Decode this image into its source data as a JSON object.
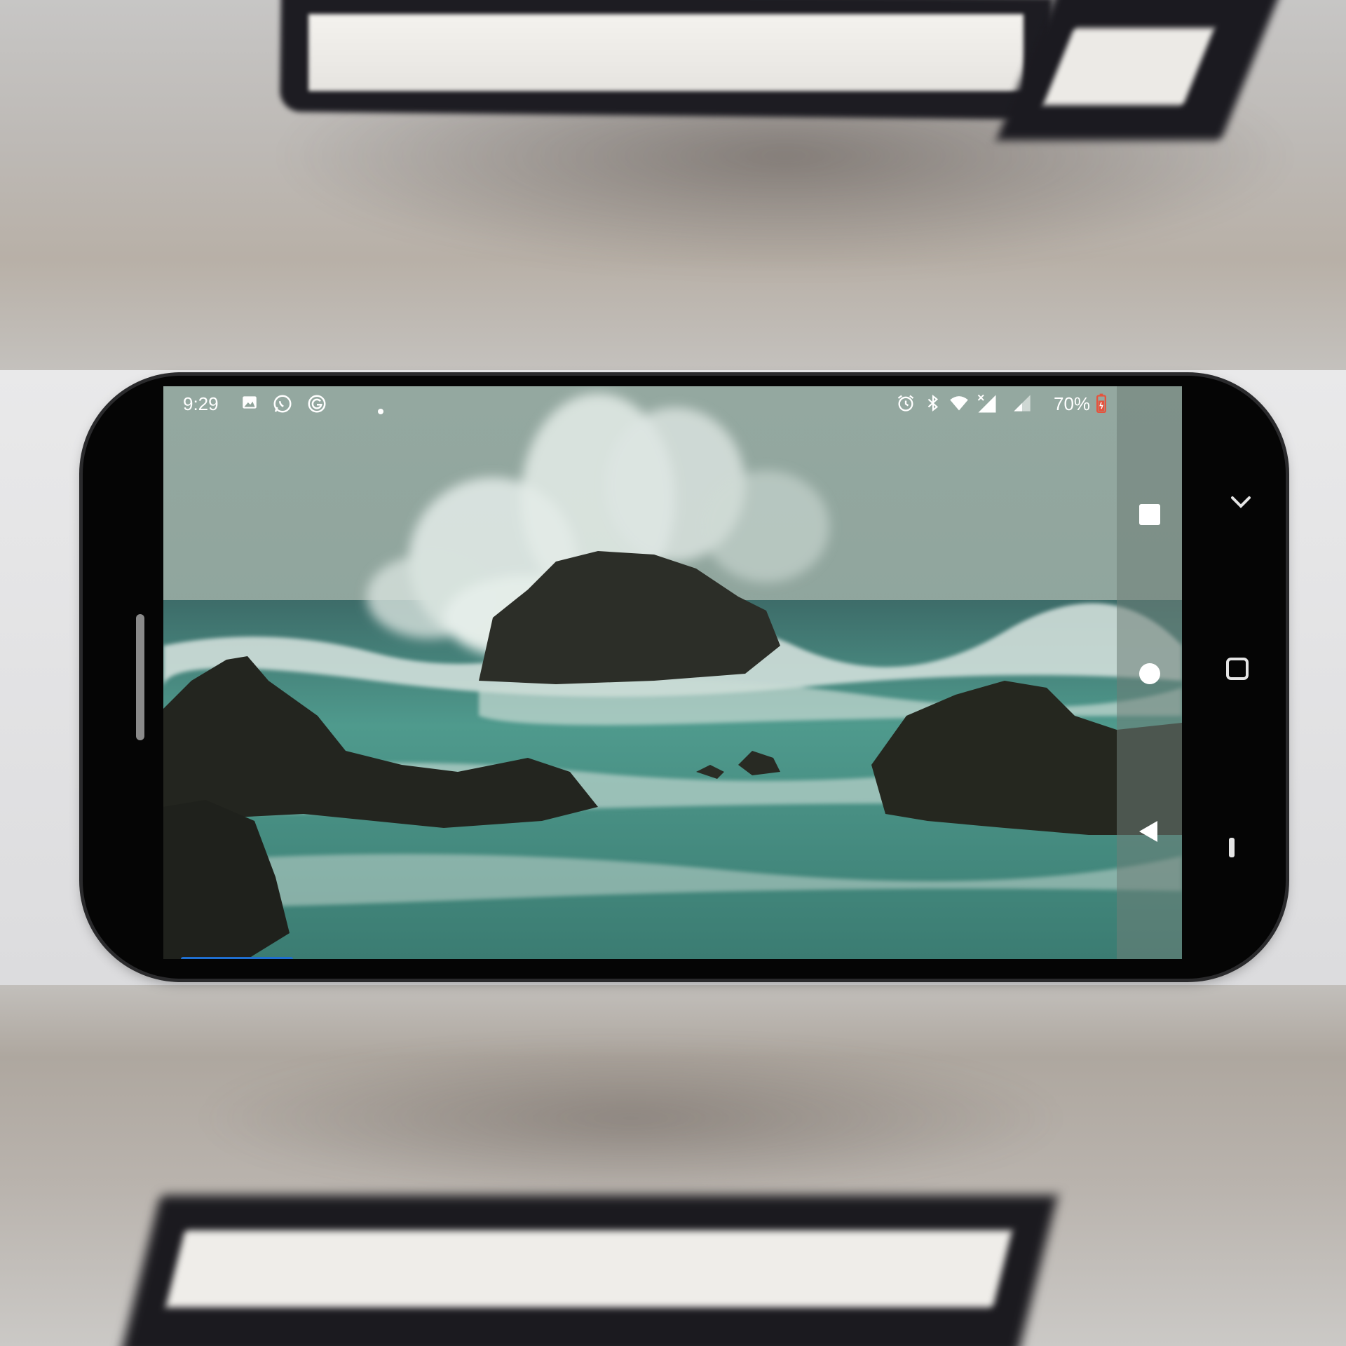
{
  "status_bar": {
    "time": "9:29",
    "left_icons": [
      "gallery-icon",
      "whatsapp-icon",
      "google-icon",
      "notification-dot-icon"
    ],
    "right_icons": [
      "alarm-icon",
      "bluetooth-icon",
      "wifi-icon",
      "signal-icon",
      "signal-2-icon",
      "battery-icon"
    ],
    "battery_percent": "70%",
    "battery_color": "#e5533d"
  },
  "nav_bar": {
    "buttons": [
      "recents-button",
      "home-button",
      "back-button"
    ]
  },
  "bezel_controls": [
    "chevron-down-icon",
    "screenshot-icon",
    "bezel-minimize-icon"
  ],
  "video": {
    "scene": "stormy-sea-rocks-video",
    "progress": 0.12,
    "progress_color": "#1f6fd0"
  },
  "colors": {
    "sky": "#8fa39a",
    "sea": "#3f8a7e",
    "foam": "#d8e4df",
    "rock": "#2a2c26"
  }
}
